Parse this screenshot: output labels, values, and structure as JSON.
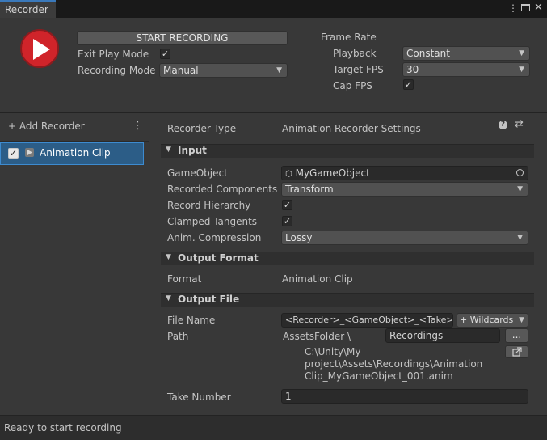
{
  "window": {
    "tab_title": "Recorder",
    "menu_icon": "kebab-icon",
    "maximize_icon": "maximize-icon",
    "close_icon": "close-icon"
  },
  "controls": {
    "start_label": "START RECORDING",
    "exit_play_mode_label": "Exit Play Mode",
    "exit_play_mode_checked": true,
    "recording_mode_label": "Recording Mode",
    "recording_mode_value": "Manual",
    "frame_rate_label": "Frame Rate",
    "playback_label": "Playback",
    "playback_value": "Constant",
    "target_fps_label": "Target FPS",
    "target_fps_value": "30",
    "cap_fps_label": "Cap FPS",
    "cap_fps_checked": true
  },
  "sidebar": {
    "add_label": "+ Add Recorder",
    "items": [
      {
        "label": "Animation Clip",
        "checked": true
      }
    ]
  },
  "inspector": {
    "recorder_type_label": "Recorder Type",
    "recorder_type_value": "Animation Recorder Settings",
    "input": {
      "header": "Input",
      "gameobject_label": "GameObject",
      "gameobject_value": "MyGameObject",
      "recorded_components_label": "Recorded Components",
      "recorded_components_value": "Transform",
      "record_hierarchy_label": "Record Hierarchy",
      "clamped_tangents_label": "Clamped Tangents",
      "anim_compression_label": "Anim. Compression",
      "anim_compression_value": "Lossy"
    },
    "output_format": {
      "header": "Output Format",
      "format_label": "Format",
      "format_value": "Animation Clip"
    },
    "output_file": {
      "header": "Output File",
      "file_name_label": "File Name",
      "file_name_value": "<Recorder>_<GameObject>_<Take>",
      "wildcards_label": "+ Wildcards",
      "path_label": "Path",
      "path_root": "AssetsFolder \\",
      "path_value": "Recordings",
      "browse_label": "...",
      "full_path_line1": "C:\\Unity\\My",
      "full_path_line2": "project\\Assets\\Recordings\\Animation",
      "full_path_line3": "Clip_MyGameObject_001.anim",
      "take_number_label": "Take Number",
      "take_number_value": "1"
    }
  },
  "status": {
    "text": "Ready to start recording"
  },
  "colors": {
    "record_red": "#d0242a",
    "selection_blue": "#2c5d87",
    "tab_accent": "#3a79bb"
  }
}
